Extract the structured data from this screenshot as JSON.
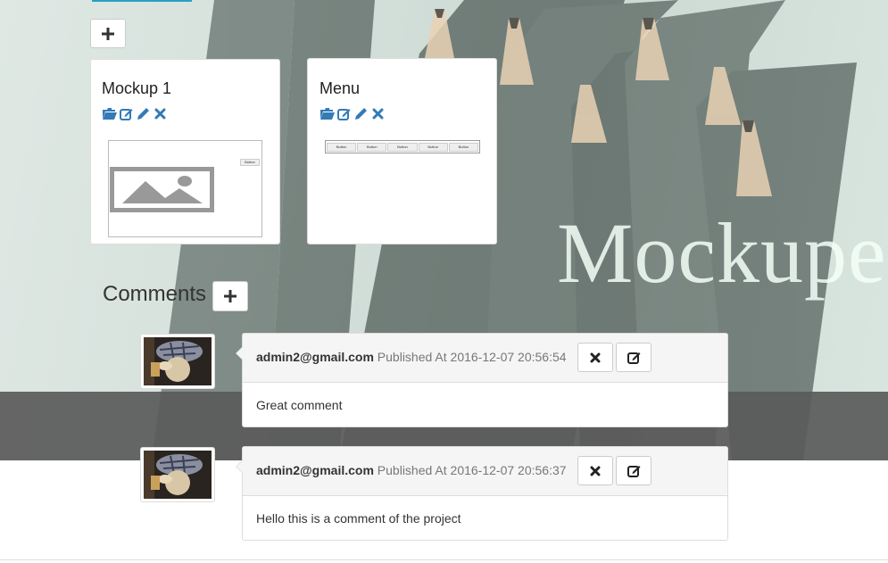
{
  "brand": {
    "text": "Mockuper"
  },
  "toolbar": {
    "add_mockup_icon": "plus-icon"
  },
  "mockups": [
    {
      "title": "Mockup 1",
      "thumb_button_label": "Button"
    },
    {
      "title": "Menu",
      "thumb_menu_items": [
        "Button",
        "Button",
        "Button",
        "Button",
        "Button"
      ]
    }
  ],
  "comments": {
    "title": "Comments",
    "items": [
      {
        "author": "admin2@gmail.com",
        "published_label": "Published At",
        "timestamp": "2016-12-07 20:56:54",
        "text": "Great comment"
      },
      {
        "author": "admin2@gmail.com",
        "published_label": "Published At",
        "timestamp": "2016-12-07 20:56:37",
        "text": "Hello this is a comment of the project"
      }
    ]
  },
  "colors": {
    "accent": "#337ab7",
    "underline": "#28a1c4",
    "band": "#5a5a5a"
  }
}
